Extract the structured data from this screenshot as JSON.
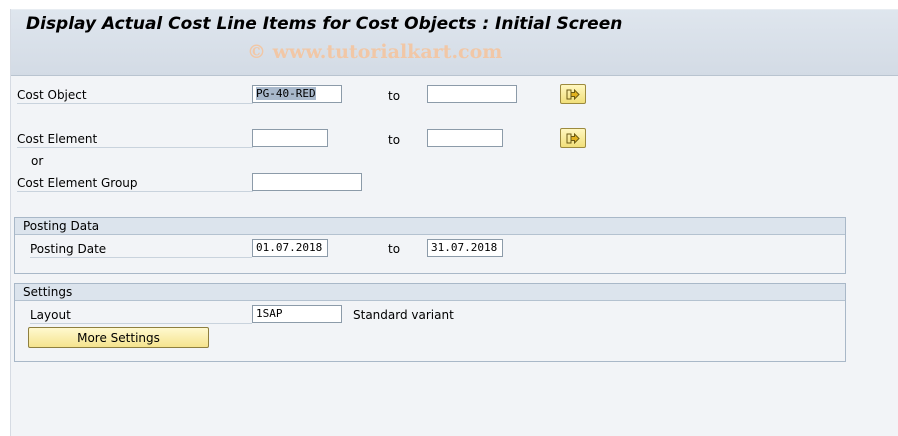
{
  "screen": {
    "title": "Display Actual Cost Line Items for Cost Objects : Initial Screen",
    "watermark": "© www.tutorialkart.com"
  },
  "selection": {
    "cost_object": {
      "label": "Cost Object",
      "from": "PG-40-RED",
      "to_label": "to",
      "to": ""
    },
    "cost_element": {
      "label": "Cost Element",
      "from": "",
      "to_label": "to",
      "to": ""
    },
    "or_label": "or",
    "cost_element_group": {
      "label": "Cost Element Group",
      "value": ""
    }
  },
  "posting_data": {
    "title": "Posting Data",
    "posting_date": {
      "label": "Posting Date",
      "from": "01.07.2018",
      "to_label": "to",
      "to": "31.07.2018"
    }
  },
  "settings": {
    "title": "Settings",
    "layout": {
      "label": "Layout",
      "value": "1SAP",
      "description": "Standard variant"
    },
    "more_settings_label": "More Settings"
  },
  "icons": {
    "multiple_selection": "multiple-selection-arrow-icon"
  },
  "colors": {
    "title_bar": "#d3dbe5",
    "button_yellow": "#f5e38e",
    "group_header": "#dce4ed",
    "selection_highlight": "#a9b9cc"
  }
}
